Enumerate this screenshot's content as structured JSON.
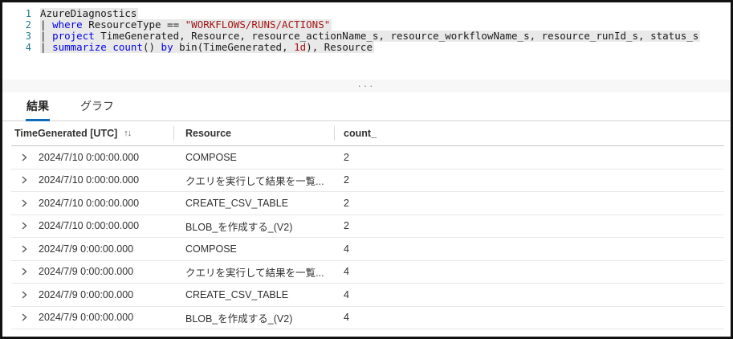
{
  "editor": {
    "lines": [
      {
        "n": "1",
        "tokens": [
          {
            "t": "AzureDiagnostics",
            "k": "plain"
          }
        ]
      },
      {
        "n": "2",
        "tokens": [
          {
            "t": "| ",
            "k": "plain"
          },
          {
            "t": "where",
            "k": "keyword"
          },
          {
            "t": " ResourceType == ",
            "k": "plain"
          },
          {
            "t": "\"WORKFLOWS/RUNS/ACTIONS\"",
            "k": "string"
          }
        ]
      },
      {
        "n": "3",
        "tokens": [
          {
            "t": "| ",
            "k": "plain"
          },
          {
            "t": "project",
            "k": "keyword"
          },
          {
            "t": " TimeGenerated, Resource, resource_actionName_s, resource_workflowName_s, resource_runId_s, status_s",
            "k": "plain"
          }
        ]
      },
      {
        "n": "4",
        "tokens": [
          {
            "t": "| ",
            "k": "plain"
          },
          {
            "t": "summarize",
            "k": "keyword"
          },
          {
            "t": " ",
            "k": "plain"
          },
          {
            "t": "count",
            "k": "keyword"
          },
          {
            "t": "() ",
            "k": "plain"
          },
          {
            "t": "by",
            "k": "keyword"
          },
          {
            "t": " bin(TimeGenerated, ",
            "k": "plain"
          },
          {
            "t": "1d",
            "k": "literal"
          },
          {
            "t": "), Resource",
            "k": "plain"
          }
        ]
      }
    ]
  },
  "splitter": {
    "handle": "···"
  },
  "tabs": [
    {
      "label": "結果",
      "selected": true
    },
    {
      "label": "グラフ",
      "selected": false
    }
  ],
  "table": {
    "columns": {
      "time": {
        "label": "TimeGenerated [UTC]",
        "sort_icon": "↑↓"
      },
      "resource": {
        "label": "Resource"
      },
      "count": {
        "label": "count_"
      }
    },
    "rows": [
      {
        "time": "2024/7/10 0:00:00.000",
        "resource": "COMPOSE",
        "count": "2"
      },
      {
        "time": "2024/7/10 0:00:00.000",
        "resource": "クエリを実行して結果を一覧...",
        "count": "2"
      },
      {
        "time": "2024/7/10 0:00:00.000",
        "resource": "CREATE_CSV_TABLE",
        "count": "2"
      },
      {
        "time": "2024/7/10 0:00:00.000",
        "resource": "BLOB_を作成する_(V2)",
        "count": "2"
      },
      {
        "time": "2024/7/9 0:00:00.000",
        "resource": "COMPOSE",
        "count": "4"
      },
      {
        "time": "2024/7/9 0:00:00.000",
        "resource": "クエリを実行して結果を一覧...",
        "count": "4"
      },
      {
        "time": "2024/7/9 0:00:00.000",
        "resource": "CREATE_CSV_TABLE",
        "count": "4"
      },
      {
        "time": "2024/7/9 0:00:00.000",
        "resource": "BLOB_を作成する_(V2)",
        "count": "4"
      }
    ]
  },
  "colors": {
    "accent": "#0f6cbd",
    "keyword": "#0000ee",
    "string": "#a31515",
    "line_number": "#237893",
    "selection_bg": "#e9e9e9"
  }
}
